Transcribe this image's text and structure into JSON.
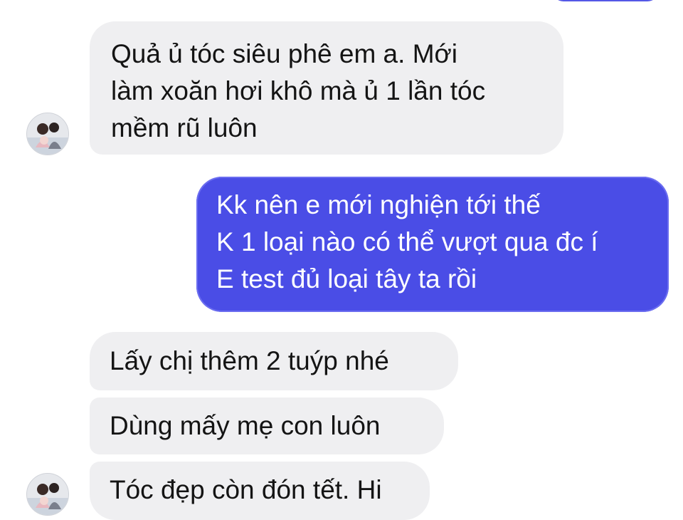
{
  "messages": [
    {
      "side": "incoming",
      "text": "Quả ủ tóc siêu phê em a. Mới\nlàm xoăn hơi khô mà ủ 1 lần tóc\nmềm rũ luôn"
    },
    {
      "side": "outgoing",
      "text": "Kk nên e mới nghiện tới thế\nK 1 loại nào có thể vượt qua đc í\nE test đủ loại tây ta rồi"
    },
    {
      "side": "incoming",
      "text": "Lấy chị thêm 2 tuýp nhé"
    },
    {
      "side": "incoming",
      "text": "Dùng mấy mẹ con luôn"
    },
    {
      "side": "incoming",
      "text": "Tóc đẹp còn đón tết. Hi"
    }
  ],
  "colors": {
    "incoming_bubble": "#efeff1",
    "outgoing_bubble": "#4a4de6",
    "incoming_text": "#141414",
    "outgoing_text": "#ffffff"
  },
  "icons": {
    "contact_avatar": "contact-avatar-photo"
  }
}
